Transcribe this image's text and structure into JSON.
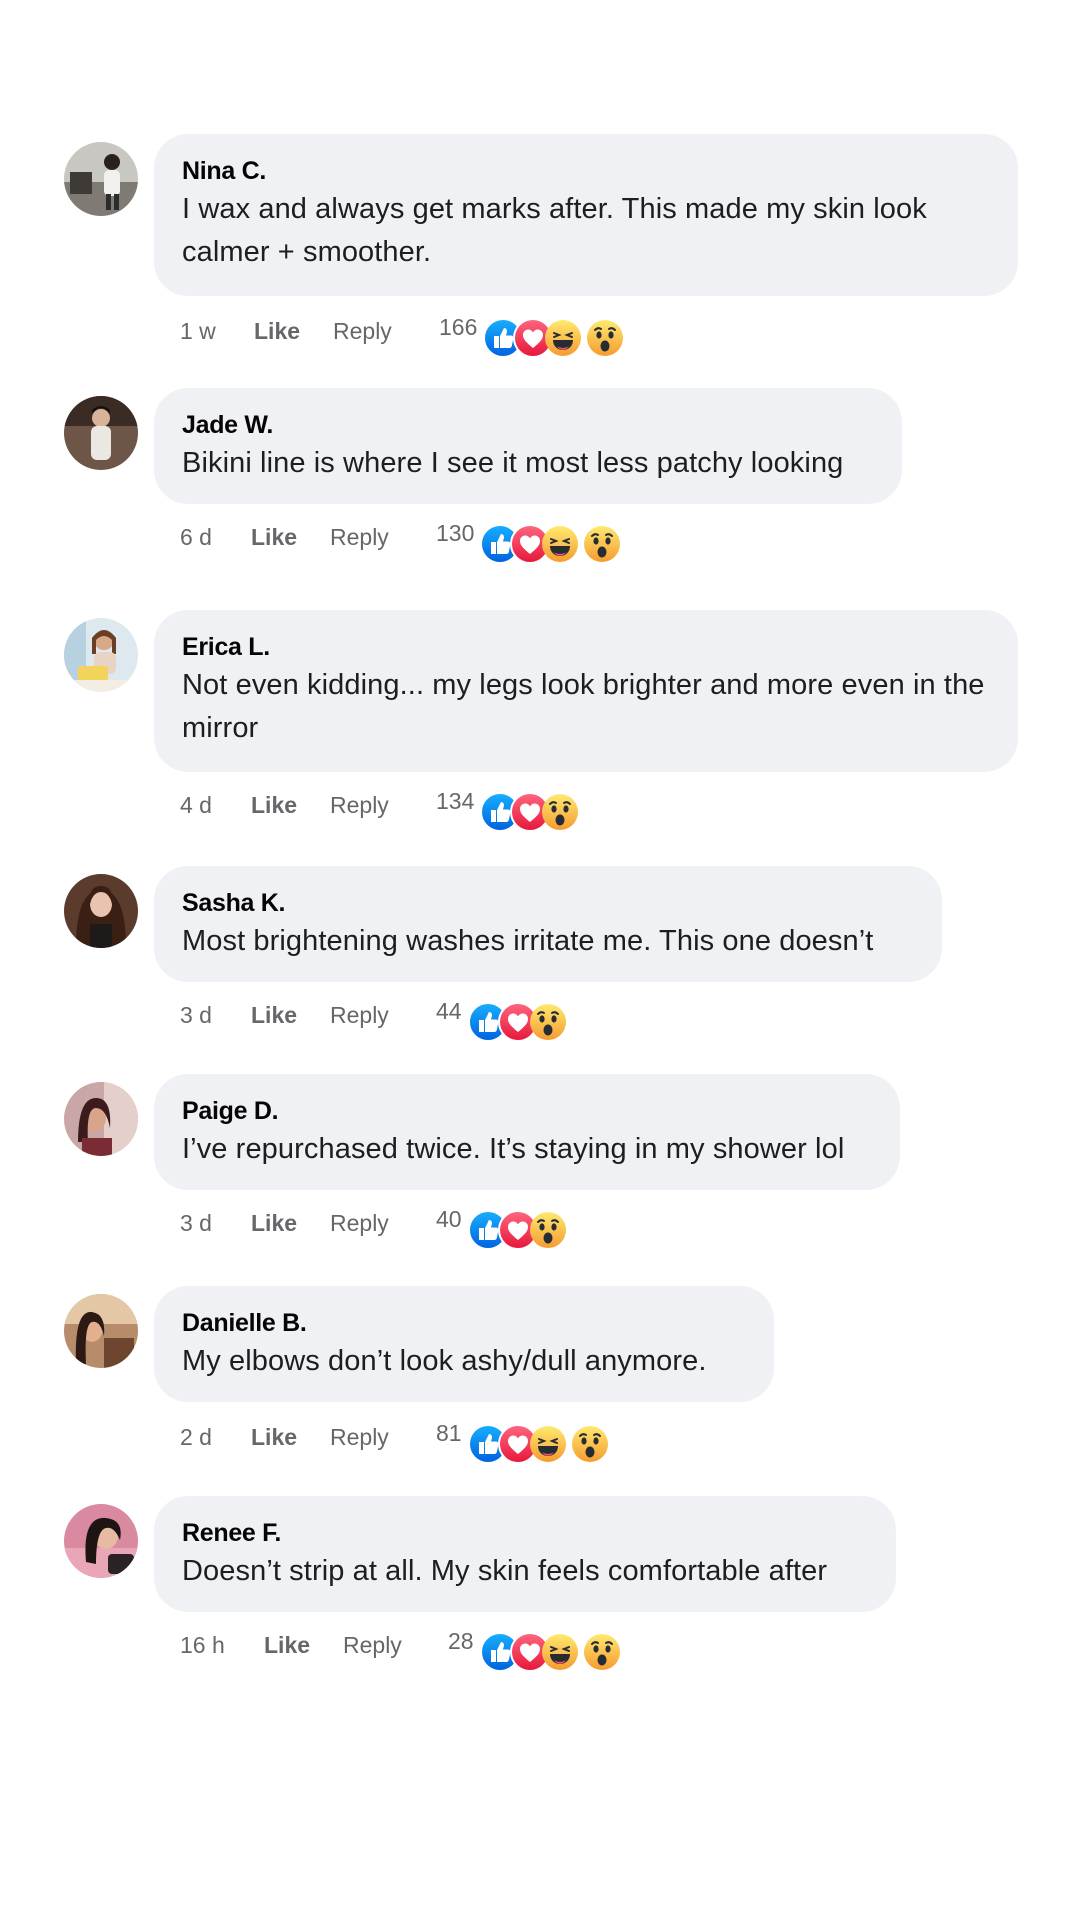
{
  "comments": [
    {
      "author": "Nina C.",
      "text": "I wax and always get marks after. This made my skin look calmer + smoother.",
      "time": "1 w",
      "like_label": "Like",
      "reply_label": "Reply",
      "reaction_count": "166",
      "reactions": [
        "like-icon",
        "love-icon",
        "haha-icon",
        "wow-icon"
      ]
    },
    {
      "author": "Jade W.",
      "text": "Bikini line is where I see it most less patchy looking",
      "time": "6 d",
      "like_label": "Like",
      "reply_label": "Reply",
      "reaction_count": "130",
      "reactions": [
        "like-icon",
        "love-icon",
        "haha-icon",
        "wow-icon"
      ]
    },
    {
      "author": "Erica L.",
      "text": "Not even kidding... my legs look brighter and more even in the mirror",
      "time": "4 d",
      "like_label": "Like",
      "reply_label": "Reply",
      "reaction_count": "134",
      "reactions": [
        "like-icon",
        "love-icon",
        "wow-icon"
      ]
    },
    {
      "author": "Sasha K.",
      "text": "Most brightening washes irritate me. This one doesn’t",
      "time": "3 d",
      "like_label": "Like",
      "reply_label": "Reply",
      "reaction_count": "44",
      "reactions": [
        "like-icon",
        "love-icon",
        "wow-icon"
      ]
    },
    {
      "author": "Paige D.",
      "text": "I’ve repurchased twice. It’s staying in my shower lol",
      "time": "3 d",
      "like_label": "Like",
      "reply_label": "Reply",
      "reaction_count": "40",
      "reactions": [
        "like-icon",
        "love-icon",
        "wow-icon"
      ]
    },
    {
      "author": "Danielle B.",
      "text": "My elbows don’t look ashy/dull anymore.",
      "time": "2 d",
      "like_label": "Like",
      "reply_label": "Reply",
      "reaction_count": "81",
      "reactions": [
        "like-icon",
        "love-icon",
        "haha-icon",
        "wow-icon"
      ]
    },
    {
      "author": "Renee F.",
      "text": "Doesn’t strip at all. My skin feels comfortable after",
      "time": "16 h",
      "like_label": "Like",
      "reply_label": "Reply",
      "reaction_count": "28",
      "reactions": [
        "like-icon",
        "love-icon",
        "haha-icon",
        "wow-icon"
      ]
    }
  ],
  "colors": {
    "bubble": "#f0f1f4",
    "meta_text": "#65676b",
    "like_blue": "#1877f2",
    "love_red": "#f33e58",
    "emoji_yellow": "#f7b125"
  }
}
